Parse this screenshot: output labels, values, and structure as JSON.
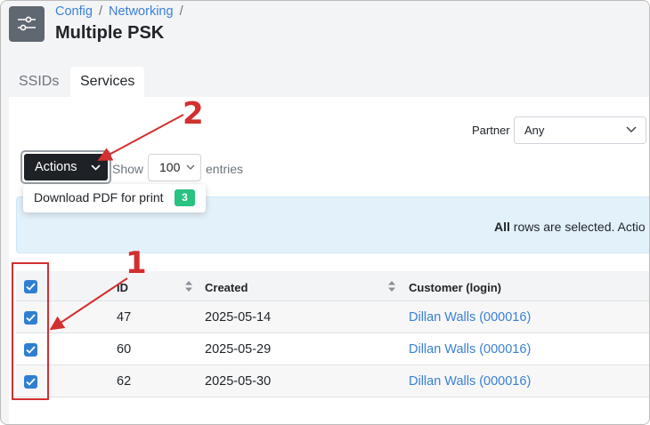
{
  "header": {
    "breadcrumb": [
      "Config",
      "Networking"
    ],
    "breadcrumb_separator": "/",
    "title": "Multiple PSK",
    "icon": "sliders-icon"
  },
  "tabs": [
    {
      "label": "SSIDs",
      "active": false
    },
    {
      "label": "Services",
      "active": true
    }
  ],
  "filters": {
    "partner_label": "Partner",
    "partner_value": "Any"
  },
  "toolbar": {
    "actions_label": "Actions",
    "show_label": "Show",
    "page_length": "100",
    "entries_label": "entries"
  },
  "dropdown": {
    "item_label": "Download PDF for print",
    "item_count": "3"
  },
  "alert": {
    "bold": "All",
    "text": " rows are selected. Actio"
  },
  "table": {
    "columns": [
      "ID",
      "Created",
      "Customer (login)"
    ],
    "rows": [
      {
        "checked": true,
        "id": "47",
        "created": "2025-05-14",
        "customer": "Dillan Walls (000016)"
      },
      {
        "checked": true,
        "id": "60",
        "created": "2025-05-29",
        "customer": "Dillan Walls (000016)"
      },
      {
        "checked": true,
        "id": "62",
        "created": "2025-05-30",
        "customer": "Dillan Walls (000016)"
      }
    ]
  },
  "annotations": {
    "marker_1": "1",
    "marker_2": "2",
    "color": "#d32f2f"
  },
  "colors": {
    "accent": "#3a80d4",
    "actions_button": "#1e2126",
    "badge": "#28c281",
    "alert_bg": "#e3f1fb",
    "checkbox": "#2f7fd1"
  }
}
